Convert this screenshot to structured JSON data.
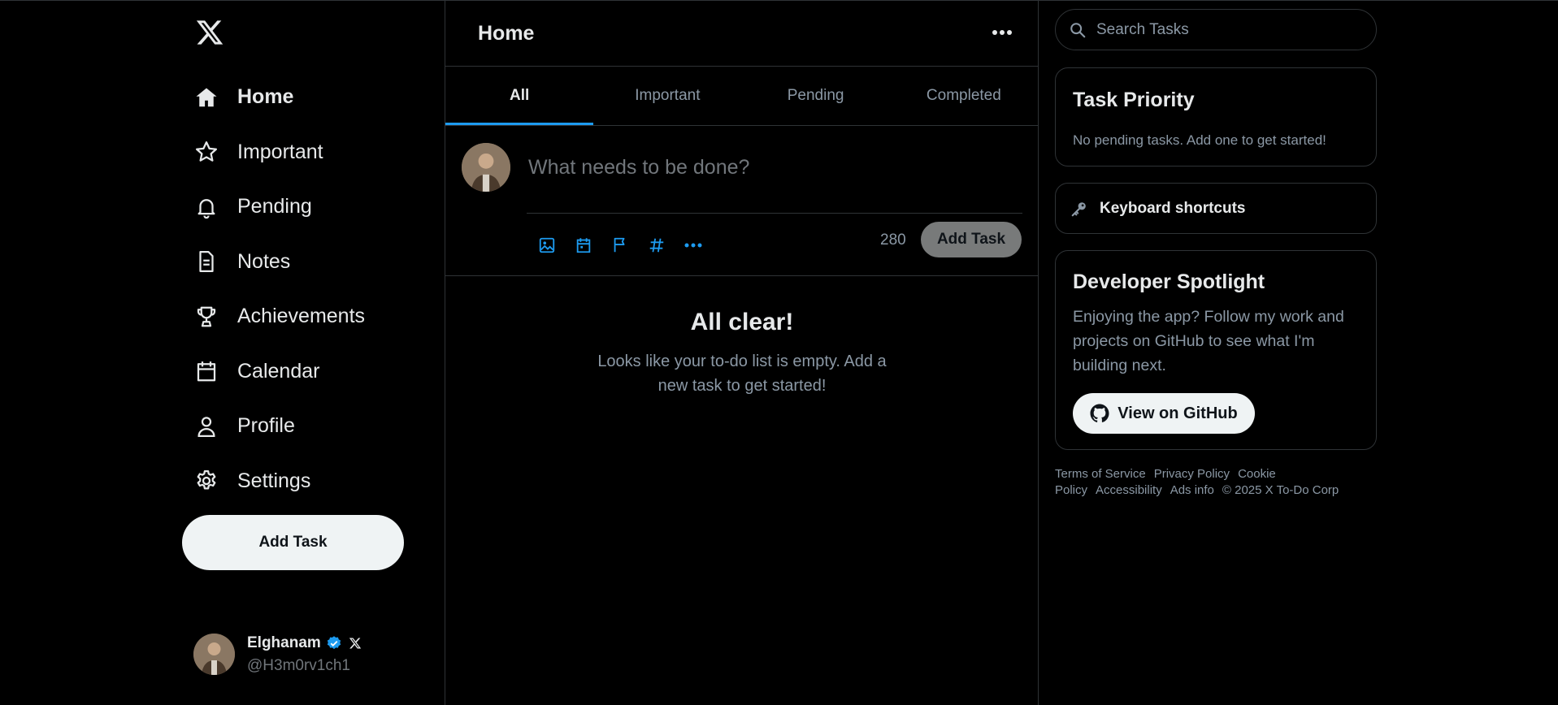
{
  "sidebar": {
    "logo": "x-logo",
    "items": [
      {
        "label": "Home",
        "icon": "home-icon",
        "active": true
      },
      {
        "label": "Important",
        "icon": "star-icon"
      },
      {
        "label": "Pending",
        "icon": "bell-icon"
      },
      {
        "label": "Notes",
        "icon": "document-icon"
      },
      {
        "label": "Achievements",
        "icon": "trophy-icon"
      },
      {
        "label": "Calendar",
        "icon": "calendar-icon"
      },
      {
        "label": "Profile",
        "icon": "person-icon"
      },
      {
        "label": "Settings",
        "icon": "gear-icon"
      }
    ],
    "add_task_label": "Add Task",
    "user": {
      "name": "Elghanam",
      "handle": "@H3m0rv1ch1"
    }
  },
  "main": {
    "title": "Home",
    "tabs": [
      {
        "label": "All",
        "active": true
      },
      {
        "label": "Important"
      },
      {
        "label": "Pending"
      },
      {
        "label": "Completed"
      }
    ],
    "composer": {
      "placeholder": "What needs to be done?",
      "char_count": "280",
      "add_task_label": "Add Task",
      "tools": [
        "image-icon",
        "calendar-icon",
        "flag-icon",
        "hashtag-icon",
        "more-icon"
      ]
    },
    "empty_state": {
      "title": "All clear!",
      "message": "Looks like your to-do list is empty. Add a new task to get started!"
    }
  },
  "right": {
    "search_placeholder": "Search Tasks",
    "priority_card": {
      "title": "Task Priority",
      "message": "No pending tasks. Add one to get started!"
    },
    "shortcuts_label": "Keyboard shortcuts",
    "dev_card": {
      "title": "Developer Spotlight",
      "text": "Enjoying the app? Follow my work and projects on GitHub to see what I'm building next.",
      "button_label": "View on GitHub"
    },
    "footer": {
      "links": [
        "Terms of Service",
        "Privacy Policy",
        "Cookie Policy",
        "Accessibility",
        "Ads info"
      ],
      "copyright": "© 2025 X To-Do Corp"
    }
  },
  "colors": {
    "accent": "#1d9bf0",
    "background": "#000000",
    "border": "#2f3336",
    "muted": "#8b98a5"
  }
}
